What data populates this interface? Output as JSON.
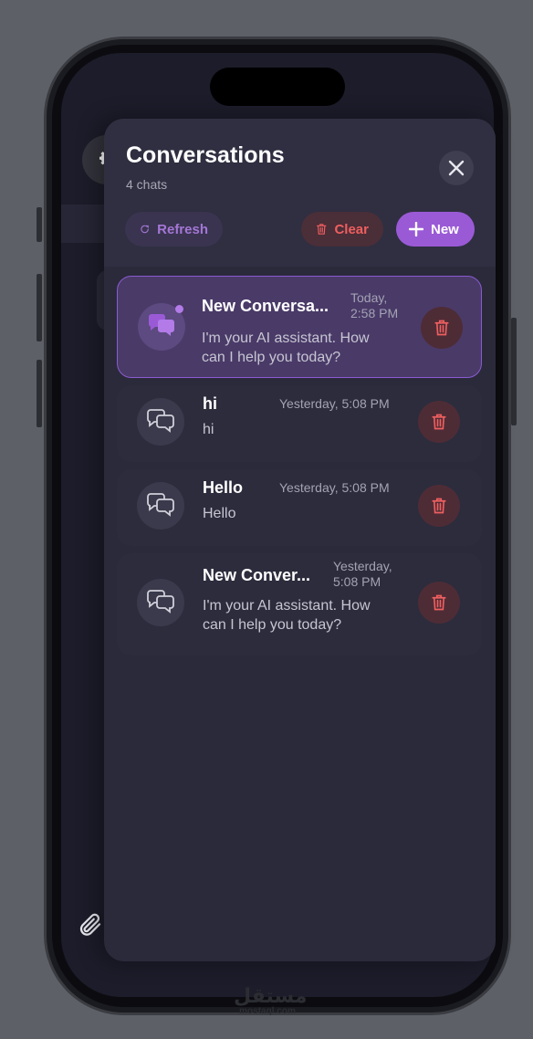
{
  "panel": {
    "title": "Conversations",
    "subtitle": "4 chats",
    "close_icon": "close-icon"
  },
  "toolbar": {
    "refresh_label": "Refresh",
    "clear_label": "Clear",
    "new_label": "New"
  },
  "conversations": [
    {
      "title": "New Conversa...",
      "time": "Today,\n2:58 PM",
      "preview": "I'm your AI assistant. How\ncan I help you today?",
      "active": true,
      "unread": true
    },
    {
      "title": "hi",
      "time": "Yesterday, 5:08 PM",
      "preview": "hi",
      "active": false,
      "unread": false
    },
    {
      "title": "Hello",
      "time": "Yesterday, 5:08 PM",
      "preview": "Hello",
      "active": false,
      "unread": false
    },
    {
      "title": "New Conver...",
      "time": "Yesterday,\n5:08 PM",
      "preview": "I'm your AI assistant. How\ncan I help you today?",
      "active": false,
      "unread": false
    }
  ],
  "watermark": {
    "arabic": "مستقل",
    "latin": "mostaql.com"
  },
  "colors": {
    "accent": "#9a5ad6",
    "danger": "#ef5f5f",
    "panel": "#2a2a3b"
  }
}
